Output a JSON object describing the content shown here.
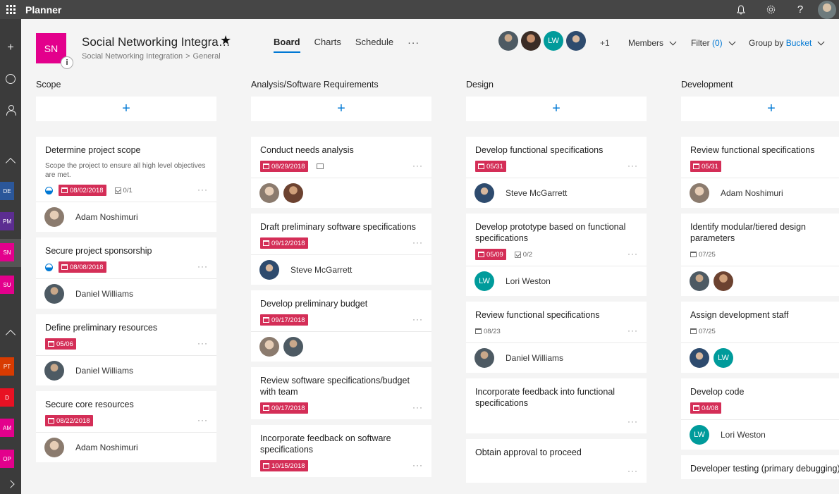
{
  "app": {
    "title": "Planner"
  },
  "rail": {
    "tiles": [
      {
        "label": "DE",
        "color": "#2b579a"
      },
      {
        "label": "PM",
        "color": "#5c2d91"
      },
      {
        "label": "SN",
        "color": "#e3008c"
      },
      {
        "label": "SU",
        "color": "#e3008c"
      },
      {
        "label": "PT",
        "color": "#d83b01"
      },
      {
        "label": "D",
        "color": "#e81123"
      },
      {
        "label": "AM",
        "color": "#e3008c"
      },
      {
        "label": "OP",
        "color": "#e3008c"
      }
    ]
  },
  "plan": {
    "tile": "SN",
    "tile_color": "#e3008c",
    "info": "i",
    "title": "Social Networking Integra…",
    "star": "★",
    "breadcrumb": {
      "group": "Social Networking Integration",
      "separator": ">",
      "channel": "General"
    }
  },
  "tabs": [
    {
      "label": "Board",
      "active": true
    },
    {
      "label": "Charts",
      "active": false
    },
    {
      "label": "Schedule",
      "active": false
    }
  ],
  "tabs_more": "···",
  "members": {
    "avatar_initials": "LW",
    "extra": "+1",
    "label": "Members"
  },
  "filter": {
    "label": "Filter",
    "count": "(0)"
  },
  "group_by": {
    "label": "Group by",
    "value": "Bucket"
  },
  "accent_color": "#0078d4",
  "due_color": "#d42e57",
  "add_task_symbol": "+",
  "buckets": [
    {
      "name": "Scope",
      "tasks": [
        {
          "title": "Determine project scope",
          "description": "Scope the project to ensure all high level objectives are met.",
          "due": "08/02/2018",
          "checklist": "0/1",
          "assignee": "Adam Noshimuri"
        },
        {
          "title": "Secure project sponsorship",
          "due": "08/08/2018",
          "assignee": "Daniel Williams"
        },
        {
          "title": "Define preliminary resources",
          "due": "05/06",
          "assignee": "Daniel Williams"
        },
        {
          "title": "Secure core resources",
          "due": "08/22/2018",
          "assignee": "Adam Noshimuri"
        }
      ]
    },
    {
      "name": "Analysis/Software Requirements",
      "tasks": [
        {
          "title": "Conduct needs analysis",
          "due": "08/29/2018"
        },
        {
          "title": "Draft preliminary software specifications",
          "due": "09/12/2018",
          "assignee": "Steve McGarrett"
        },
        {
          "title": "Develop preliminary budget",
          "due": "09/17/2018"
        },
        {
          "title": "Review software specifications/budget with team",
          "due": "09/17/2018"
        },
        {
          "title": "Incorporate feedback on software specifications",
          "due": "10/15/2018"
        }
      ]
    },
    {
      "name": "Design",
      "tasks": [
        {
          "title": "Develop functional specifications",
          "due": "05/31",
          "assignee": "Steve McGarrett"
        },
        {
          "title": "Develop prototype based on functional specifications",
          "due": "05/09",
          "checklist": "0/2",
          "assignee": "Lori Weston",
          "assignee_initials": "LW"
        },
        {
          "title": "Review functional specifications",
          "due": "08/23",
          "assignee": "Daniel Williams"
        },
        {
          "title": "Incorporate feedback into functional specifications"
        },
        {
          "title": "Obtain approval to proceed"
        }
      ]
    },
    {
      "name": "Development",
      "tasks": [
        {
          "title": "Review functional specifications",
          "due": "05/31",
          "assignee": "Adam Noshimuri"
        },
        {
          "title": "Identify modular/tiered design parameters",
          "due": "07/25"
        },
        {
          "title": "Assign development staff",
          "due": "07/25",
          "assignee_initials": "LW"
        },
        {
          "title": "Develop code",
          "due": "04/08",
          "assignee": "Lori Weston",
          "assignee_initials": "LW"
        },
        {
          "title": "Developer testing (primary debugging)"
        }
      ]
    }
  ],
  "more_symbol": "···"
}
